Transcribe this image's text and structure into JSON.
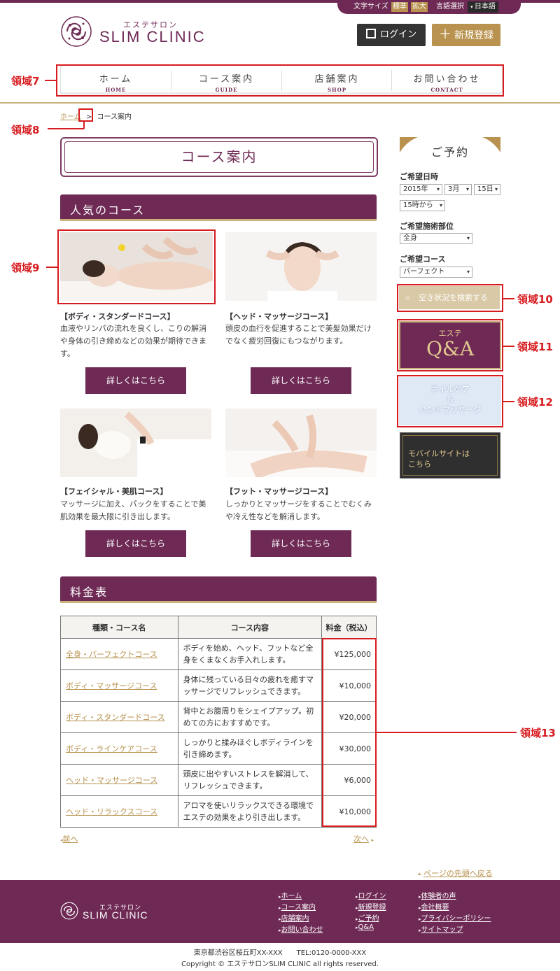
{
  "topbar": {
    "font_size_label": "文字サイズ",
    "font_standard": "標準",
    "font_large": "拡大",
    "lang_label": "言語選択",
    "lang_value": "日本語"
  },
  "header": {
    "logo_sub": "エステサロン",
    "logo_main": "SLIM CLINIC",
    "login": "ログイン",
    "register": "新規登録"
  },
  "nav": [
    {
      "jp": "ホーム",
      "en": "HOME"
    },
    {
      "jp": "コース案内",
      "en": "GUIDE"
    },
    {
      "jp": "店舗案内",
      "en": "SHOP"
    },
    {
      "jp": "お問い合わせ",
      "en": "CONTACT"
    }
  ],
  "annotations": {
    "a7": "領域7",
    "a8": "領域8",
    "a9": "領域9",
    "a10": "領域10",
    "a11": "領域11",
    "a12": "領域12",
    "a13": "領域13"
  },
  "breadcrumb": {
    "home": "ホーム",
    "sep": ">",
    "current": "コース案内"
  },
  "page_title": "コース案内",
  "popular": {
    "heading": "人気のコース",
    "courses": [
      {
        "title": "【ボディ・スタンダードコース】",
        "desc": "血液やリンパの流れを良くし、こりの解消や身体の引き締めなどの効果が期待できます。",
        "button": "詳しくはこちら"
      },
      {
        "title": "【ヘッド・マッサージコース】",
        "desc": "頭皮の血行を促進することで美髪効果だけでなく疲労回復にもつながります。",
        "button": "詳しくはこちら"
      },
      {
        "title": "【フェイシャル・美肌コース】",
        "desc": "マッサージに加え、パックをすることで美肌効果を最大限に引き出します。",
        "button": "詳しくはこちら"
      },
      {
        "title": "【フット・マッサージコース】",
        "desc": "しっかりとマッサージをすることでむくみや冷え性などを解消します。",
        "button": "詳しくはこちら"
      }
    ]
  },
  "price": {
    "heading": "料金表",
    "headers": [
      "種類・コース名",
      "コース内容",
      "料金（税込）"
    ],
    "rows": [
      {
        "name": "全身・パーフェクトコース",
        "desc": "ボディを始め、ヘッド、フットなど全身をくまなくお手入れします。",
        "fee": "¥125,000"
      },
      {
        "name": "ボディ・マッサージコース",
        "desc": "身体に残っている日々の疲れを癒すマッサージでリフレッシュできます。",
        "fee": "¥10,000"
      },
      {
        "name": "ボディ・スタンダードコース",
        "desc": "背中とお腹周りをシェイプアップ。初めての方におすすめです。",
        "fee": "¥20,000"
      },
      {
        "name": "ボディ・ラインケアコース",
        "desc": "しっかりと揉みほぐしボディラインを引き締めます。",
        "fee": "¥30,000"
      },
      {
        "name": "ヘッド・マッサージコース",
        "desc": "頭皮に出やすいストレスを解消して、リフレッシュできます。",
        "fee": "¥6,000"
      },
      {
        "name": "ヘッド・リラックスコース",
        "desc": "アロマを使いリラックスできる環境でエステの効果をより引き出します。",
        "fee": "¥10,000"
      }
    ],
    "prev": "前へ",
    "next": "次へ",
    "to_top": "ページの先頭へ戻る"
  },
  "reserve": {
    "heading": "ご予約",
    "date_label": "ご希望日時",
    "year": "2015年",
    "month": "3月",
    "day": "15日",
    "time": "15時から",
    "part_label": "ご希望施術部位",
    "part": "全身",
    "course_label": "ご希望コース",
    "course": "パーフェクト",
    "search": "空き状況を検索する"
  },
  "banners": {
    "qa_small": "エステ",
    "qa_big": "Q&A",
    "nail_1": "ネイルケア",
    "nail_amp": "&",
    "nail_2": "ハンドマッサージ",
    "mobile_1": "モバイルサイトは",
    "mobile_2": "こちら"
  },
  "footer": {
    "logo_sub": "エステサロン",
    "logo_main": "SLIM CLINIC",
    "col1": [
      "ホーム",
      "コース案内",
      "店舗案内",
      "お問い合わせ"
    ],
    "col2": [
      "ログイン",
      "新規登録",
      "ご予約",
      "Q&A"
    ],
    "col3": [
      "体験者の声",
      "会社概要",
      "プライバシーポリシー",
      "サイトマップ"
    ],
    "address": "東京都渋谷区桜丘町XX-XXX　　TEL:0120-0000-XXX",
    "copyright": "Copyright © エステサロンSLIM CLINIC all rights reserved."
  },
  "colors": {
    "brand": "#6e2a55",
    "gold": "#b8924e",
    "annotation": "#d71c20"
  }
}
